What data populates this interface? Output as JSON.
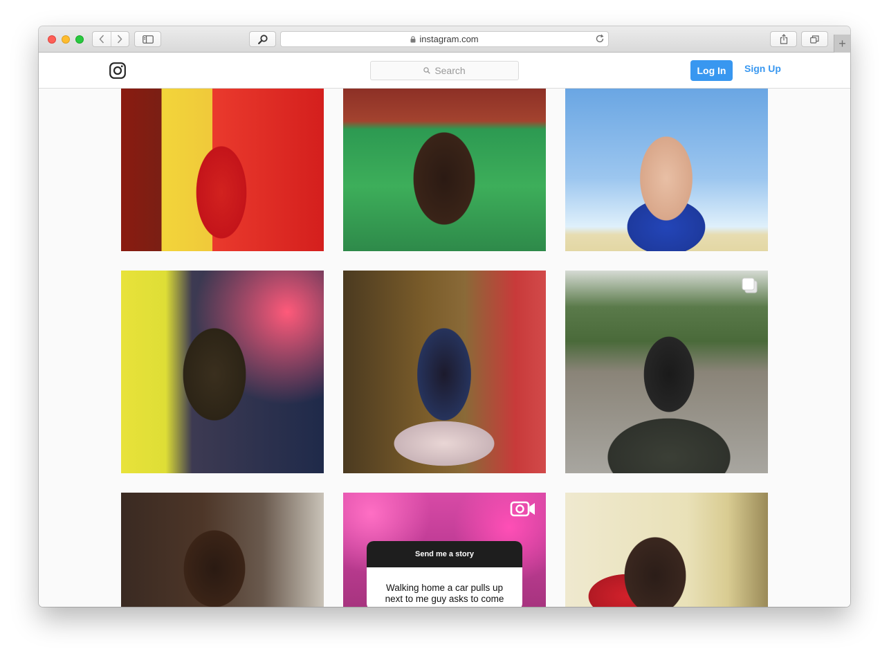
{
  "browser": {
    "url": "instagram.com",
    "new_tab_label": "+"
  },
  "header": {
    "search_placeholder": "Search",
    "login_label": "Log In",
    "signup_label": "Sign Up"
  },
  "grid": {
    "story_card": {
      "title": "Send me a story",
      "text_line1": "Walking home a car pulls up",
      "text_line2": "next to me guy asks to come"
    }
  },
  "colors": {
    "accent": "#3897f0",
    "border": "#dbdbdb",
    "background": "#fafafa"
  }
}
